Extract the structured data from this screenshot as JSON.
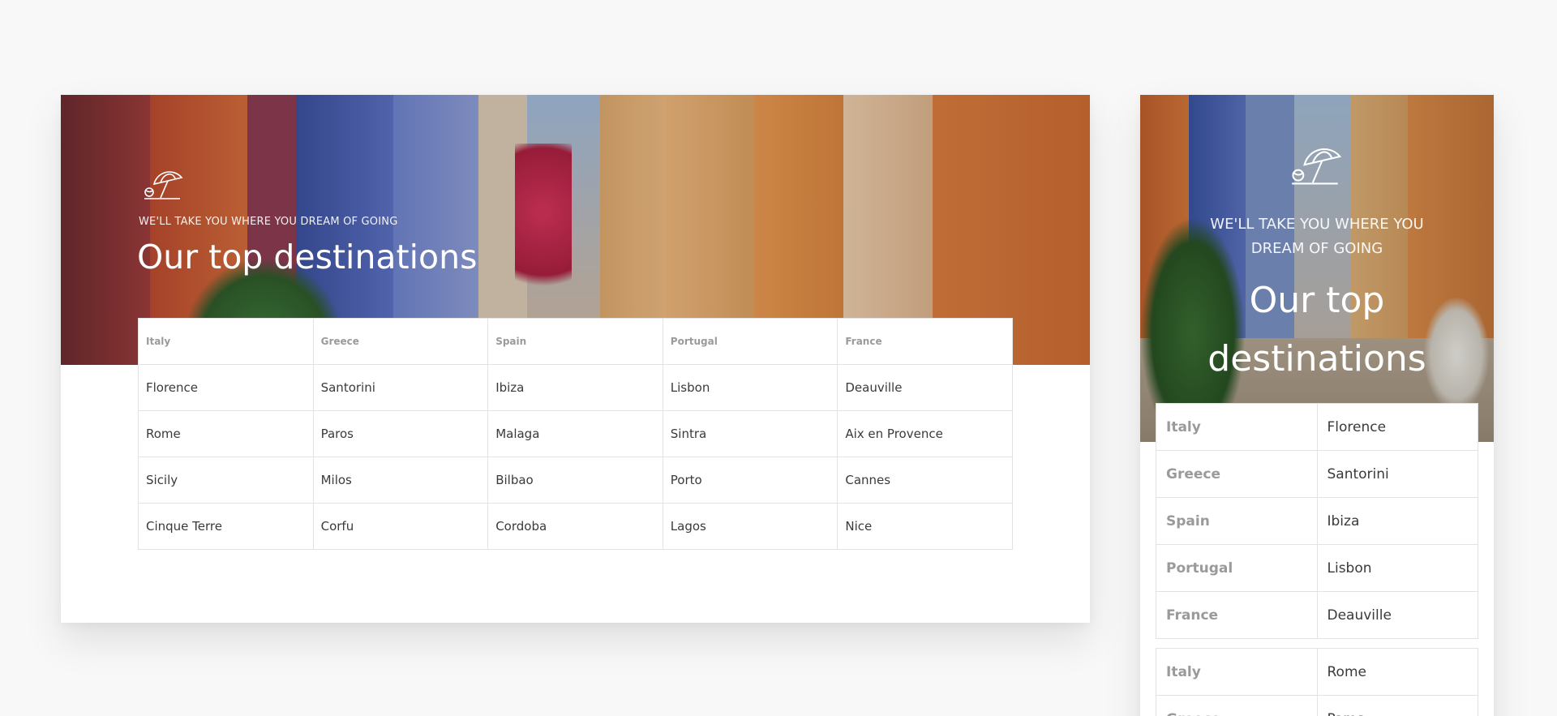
{
  "desktop": {
    "kicker": "WE'LL TAKE YOU WHERE YOU DREAM OF GOING",
    "title": "Our top destinations",
    "columns": [
      "Italy",
      "Greece",
      "Spain",
      "Portugal",
      "France"
    ],
    "rows": [
      [
        "Florence",
        "Santorini",
        "Ibiza",
        "Lisbon",
        "Deauville"
      ],
      [
        "Rome",
        "Paros",
        "Malaga",
        "Sintra",
        "Aix en Provence"
      ],
      [
        "Sicily",
        "Milos",
        "Bilbao",
        "Porto",
        "Cannes"
      ],
      [
        "Cinque Terre",
        "Corfu",
        "Cordoba",
        "Lagos",
        "Nice"
      ]
    ]
  },
  "mobile": {
    "kicker_line1": "WE'LL TAKE YOU WHERE YOU",
    "kicker_line2": "DREAM OF GOING",
    "title_line1": "Our top",
    "title_line2": "destinations",
    "pairs": [
      {
        "country": "Italy",
        "city": "Florence"
      },
      {
        "country": "Greece",
        "city": "Santorini"
      },
      {
        "country": "Spain",
        "city": "Ibiza"
      },
      {
        "country": "Portugal",
        "city": "Lisbon"
      },
      {
        "country": "France",
        "city": "Deauville"
      }
    ],
    "pairs_group2": [
      {
        "country": "Italy",
        "city": "Rome"
      },
      {
        "country": "Greece",
        "city": "Paros"
      }
    ]
  },
  "icons": {
    "hero_icon": "beach-umbrella-icon"
  },
  "colors": {
    "page_bg": "#f8f8f8",
    "header_text": "#9a9a9a",
    "cell_text": "#3a3a3a",
    "border": "#e3e3e3"
  }
}
